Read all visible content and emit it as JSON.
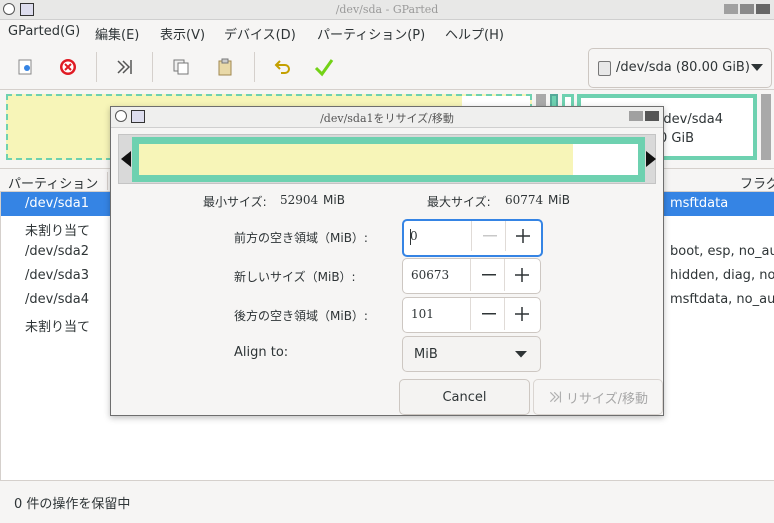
{
  "window": {
    "title": "/dev/sda - GParted"
  },
  "menu": [
    "GParted(G)",
    "編集(E)",
    "表示(V)",
    "デバイス(D)",
    "パーティション(P)",
    "ヘルプ(H)"
  ],
  "toolbar": {
    "icons": [
      "new-partition-icon",
      "delete-icon",
      "resize-move-icon",
      "copy-icon",
      "paste-icon",
      "undo-icon",
      "apply-icon"
    ],
    "device": "/dev/sda (80.00 GiB)"
  },
  "graph": {
    "sda4_name": "/dev/sda4",
    "sda4_size": "0 GiB"
  },
  "list": {
    "col_partition": "パーティション",
    "col_flags": "フラグ",
    "rows": [
      {
        "name": "/dev/sda1",
        "flags": "msftdata",
        "selected": true
      },
      {
        "name": "未割り当て",
        "flags": ""
      },
      {
        "name": "/dev/sda2",
        "flags": "boot, esp, no_au"
      },
      {
        "name": "/dev/sda3",
        "flags": "hidden, diag, no_"
      },
      {
        "name": "/dev/sda4",
        "flags": "msftdata, no_au"
      },
      {
        "name": "未割り当て",
        "flags": ""
      }
    ]
  },
  "status": "0 件の操作を保留中",
  "dialog": {
    "title": "/dev/sda1をリサイズ/移動",
    "min_label": "最小サイズ:",
    "min_value": "52904",
    "min_unit": "MiB",
    "max_label": "最大サイズ:",
    "max_value": "60774",
    "max_unit": "MiB",
    "fields": {
      "free_before": {
        "label": "前方の空き領域（MiB）:",
        "value": "0"
      },
      "new_size": {
        "label": "新しいサイズ（MiB）:",
        "value": "60673"
      },
      "free_after": {
        "label": "後方の空き領域（MiB）:",
        "value": "101"
      }
    },
    "align_label": "Align to:",
    "align_value": "MiB",
    "cancel": "Cancel",
    "resize": "リサイズ/移動"
  },
  "colors": {
    "partition_fill": "#f7f5b8",
    "partition_border": "#6ed1b0",
    "selection": "#3584e4",
    "delete_red": "#e01b24",
    "apply_green": "#73d216",
    "undo_yellow": "#c4a000"
  }
}
